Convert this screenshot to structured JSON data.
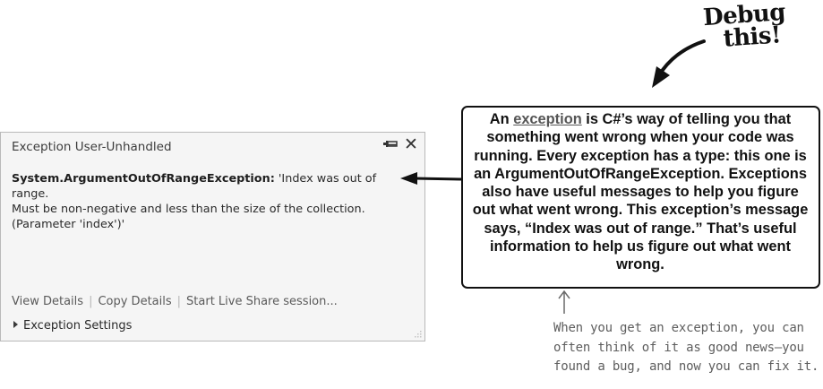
{
  "dialog": {
    "title": "Exception User-Unhandled",
    "exception_type": "System.ArgumentOutOfRangeException:",
    "message_line1": " 'Index was out of range.",
    "message_line2": "Must be non-negative and less than the size of the collection.",
    "message_line3": "(Parameter 'index')'",
    "links": [
      "View Details",
      "Copy Details",
      "Start Live Share session..."
    ],
    "settings_label": "Exception Settings",
    "icons": [
      "pin-icon",
      "close-icon",
      "expand-triangle-icon",
      "resize-grip-icon"
    ]
  },
  "callout": {
    "prefix": "An ",
    "link_word": "exception",
    "body": " is C#’s way of telling you that something went wrong when your code was running. Every exception has a type: this one is an ArgumentOutOfRangeException. Exceptions also have useful messages to help you figure out what went wrong. This exception’s message says, “Index was out of range.” That’s useful information to help us figure out what went wrong."
  },
  "notes": {
    "debug_line1": "Debug",
    "debug_line2": "this!",
    "good_news_lines": [
      "When you get an exception, you can",
      "often think of it as good news—you",
      "found a bug, and now you can fix it."
    ]
  },
  "colors": {
    "dialog_bg": "#f5f5f5",
    "dialog_border": "#b9b9b9",
    "text_dark": "#1e1e1e",
    "handwriting_gray": "#5e5e5e"
  }
}
